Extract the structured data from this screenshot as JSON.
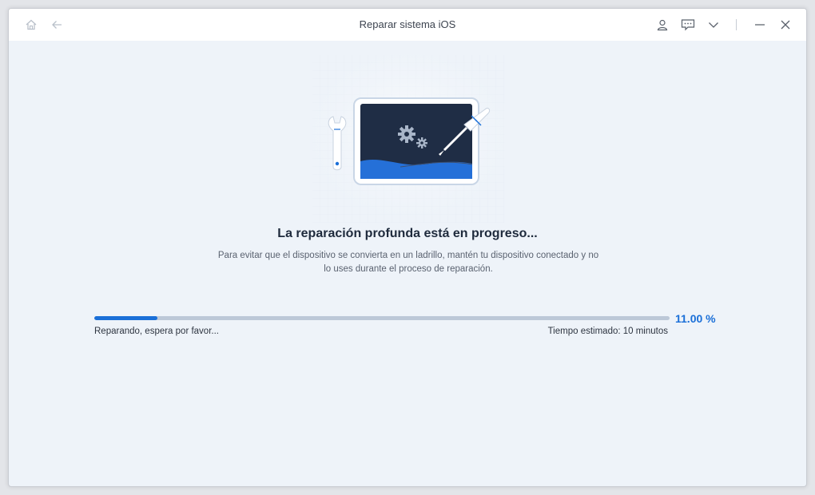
{
  "window": {
    "title": "Reparar sistema iOS"
  },
  "icons": {
    "home": "home-icon",
    "back": "back-arrow-icon",
    "account": "user-icon",
    "feedback": "chat-icon",
    "menu": "chevron-down-icon",
    "minimize": "minimize-icon",
    "close": "close-icon"
  },
  "main": {
    "heading": "La reparación profunda está en progreso...",
    "description_line1": "Para evitar que el dispositivo se convierta en un ladrillo, mantén tu dispositivo conectado y no",
    "description_line2": "lo uses durante el proceso de reparación."
  },
  "progress": {
    "fraction": 0.11,
    "percent_text": "11.00 %",
    "status_text": "Reparando, espera por favor...",
    "eta_text": "Tiempo estimado: 10 minutos"
  },
  "colors": {
    "accent": "#1a6fd8",
    "screen": "#1f2d45",
    "track": "#bcc8d8"
  }
}
